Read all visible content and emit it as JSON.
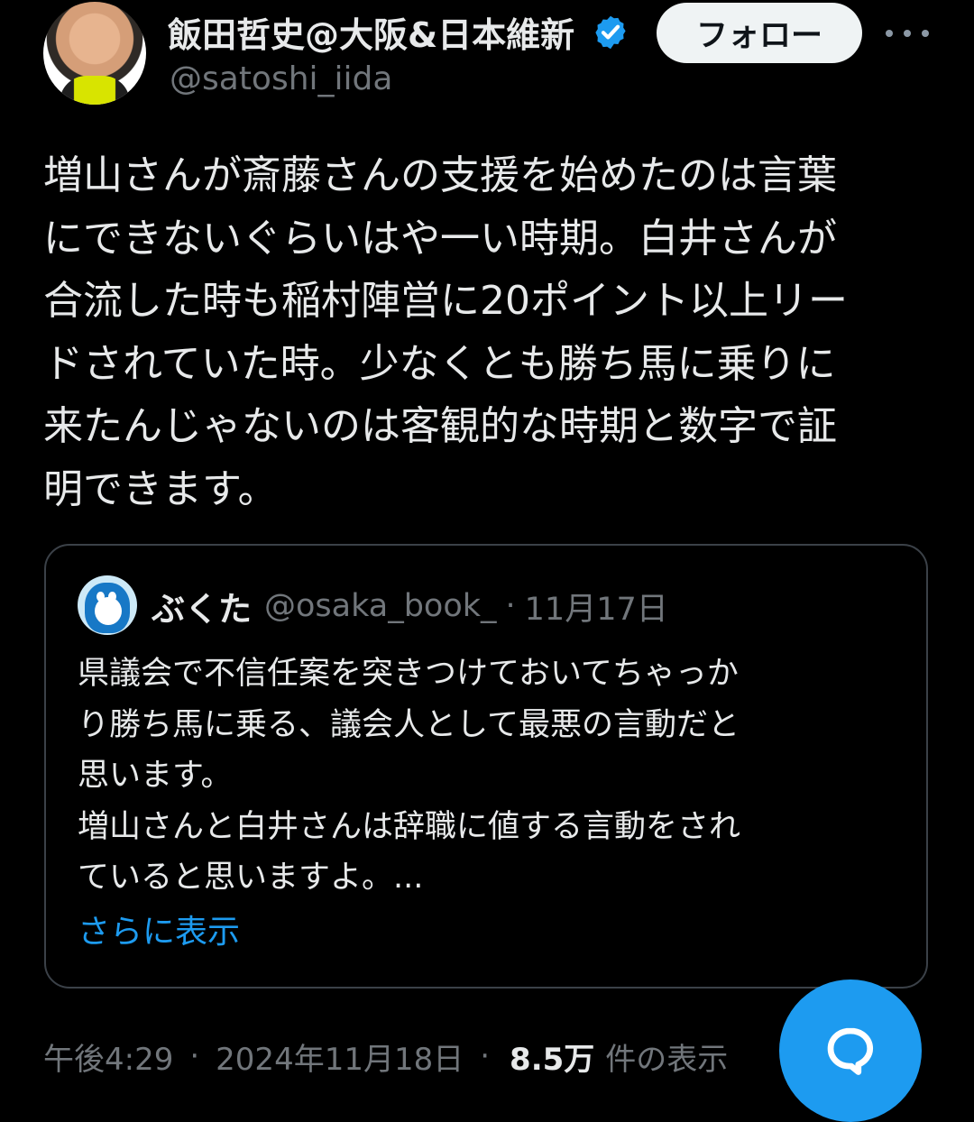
{
  "author": {
    "name": "飯田哲史@大阪&日本維新",
    "handle": "@satoshi_iida",
    "follow_label": "フォロー"
  },
  "tweet": {
    "text": "増山さんが斎藤さんの支援を始めたのは言葉\nにできないぐらいはや一い時期。白井さんが\n合流した時も稲村陣営に20ポイント以上リー\nドされていた時。少なくとも勝ち馬に乗りに\n来たんじゃないのは客観的な時期と数字で証\n明できます。"
  },
  "quote": {
    "name": "ぶくた",
    "handle": "@osaka_book_",
    "separator": "·",
    "date": "11月17日",
    "text": "県議会で不信任案を突きつけておいてちゃっか\nり勝ち馬に乗る、議会人として最悪の言動だと\n思います。\n増山さんと白井さんは辞職に値する言動をされ\nていると思いますよ。...",
    "show_more_label": "さらに表示"
  },
  "footer": {
    "time": "午後4:29",
    "separator1": "·",
    "date": "2024年11月18日",
    "separator2": "·",
    "views_count": "8.5万",
    "views_label": "件の表示"
  },
  "icons": {
    "verified": "verified-badge-icon",
    "more": "more-icon",
    "reply": "reply-fab-icon"
  },
  "colors": {
    "background": "#000000",
    "accent": "#1d9bf0",
    "secondary": "#71767b"
  }
}
